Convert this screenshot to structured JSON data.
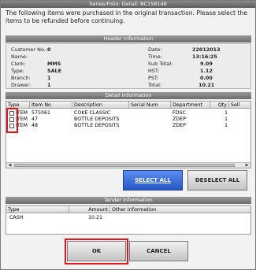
{
  "window": {
    "title": "Series/Folio: Detail: BC158149"
  },
  "instructions": "The following items were purchased in the original transaction. Please select the items to be refunded before continuing.",
  "header_info": {
    "title": "Header Information",
    "left": [
      {
        "label": "Customer No.:",
        "value": "0"
      },
      {
        "label": "Name:",
        "value": ""
      },
      {
        "label": "Clerk:",
        "value": "MMS"
      },
      {
        "label": "Type:",
        "value": "SALE"
      },
      {
        "label": "Branch:",
        "value": "1"
      },
      {
        "label": "Drawer:",
        "value": "1"
      }
    ],
    "right": [
      {
        "label": "Date:",
        "value": "22012013"
      },
      {
        "label": "Time:",
        "value": "13:16:25"
      },
      {
        "label": "Sub Total:",
        "value": "9.09"
      },
      {
        "label": "HST:",
        "value": "1.12"
      },
      {
        "label": "PST:",
        "value": "0.00"
      },
      {
        "label": "Total:",
        "value": "10.21"
      }
    ]
  },
  "detail_info": {
    "title": "Detail Information",
    "columns": [
      "Type",
      "Item No",
      "Description",
      "Serial Num",
      "Department",
      "Qty",
      "Sell"
    ],
    "rows": [
      {
        "type": "ITEM",
        "item_no": "575061",
        "description": "COKE CLASSIC",
        "serial": "",
        "department": "FDSC",
        "qty": "1",
        "checked": false
      },
      {
        "type": "ITEM",
        "item_no": "47",
        "description": "BOTTLE DEPOSITS",
        "serial": "",
        "department": "ZDEP",
        "qty": "1",
        "checked": false
      },
      {
        "type": "ITEM",
        "item_no": "48",
        "description": "BOTTLE DEPOSITS",
        "serial": "",
        "department": "ZDEP",
        "qty": "1",
        "checked": false
      }
    ]
  },
  "buttons": {
    "select_all": "SELECT ALL",
    "deselect_all": "DESELECT ALL",
    "ok": "OK",
    "cancel": "CANCEL"
  },
  "tender_info": {
    "title": "Tender Information",
    "columns": [
      "Type",
      "Amount",
      "Other Information"
    ],
    "rows": [
      {
        "type": "CASH",
        "amount": "10.21",
        "other": ""
      }
    ]
  },
  "colors": {
    "highlight": "#e0141a",
    "accent_button": "#2456c8"
  }
}
